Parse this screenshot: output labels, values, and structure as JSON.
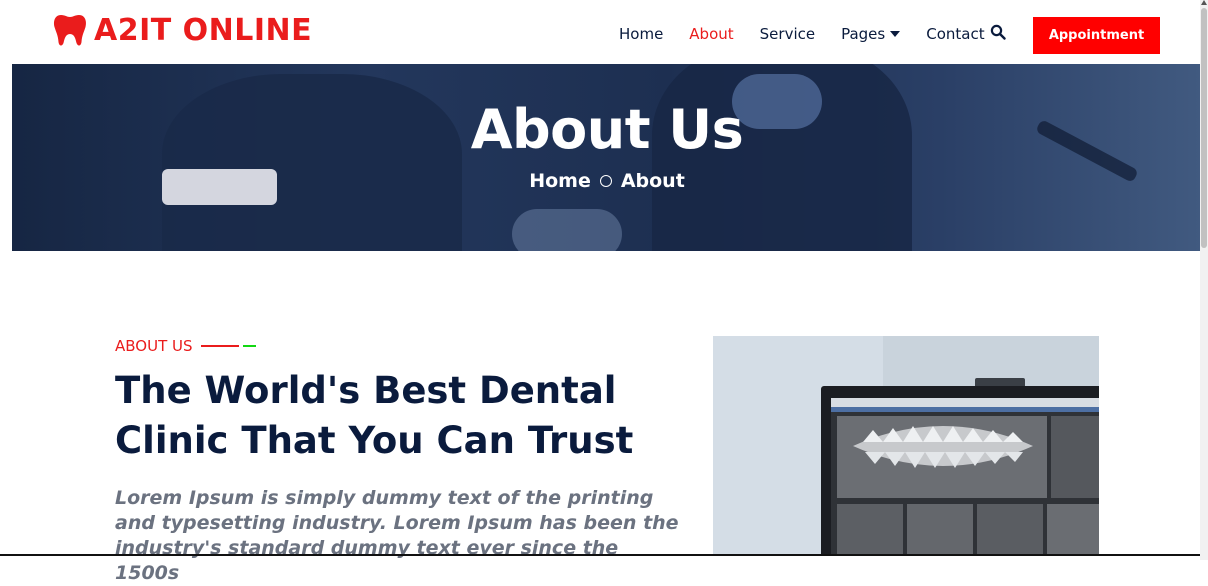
{
  "brand": {
    "name": "A2IT ONLINE",
    "logo_icon": "tooth-icon",
    "color": "#ea1c1c"
  },
  "nav": {
    "items": [
      {
        "label": "Home",
        "active": false
      },
      {
        "label": "About",
        "active": true
      },
      {
        "label": "Service",
        "active": false
      },
      {
        "label": "Pages",
        "active": false,
        "dropdown": true
      },
      {
        "label": "Contact",
        "active": false
      }
    ],
    "search_icon": "search-icon",
    "appointment_label": "Appointment",
    "accent_color": "#ff0000"
  },
  "page_header": {
    "title": "About Us",
    "breadcrumb": [
      "Home",
      "About"
    ],
    "separator_icon": "circle-icon"
  },
  "about": {
    "label": "ABOUT US",
    "heading": "The World's Best Dental Clinic That You Can Trust",
    "description": "Lorem Ipsum is simply dummy text of the printing and typesetting industry. Lorem Ipsum has been the industry's standard dummy text ever since the 1500s",
    "heading_color": "#0a1b3d"
  }
}
